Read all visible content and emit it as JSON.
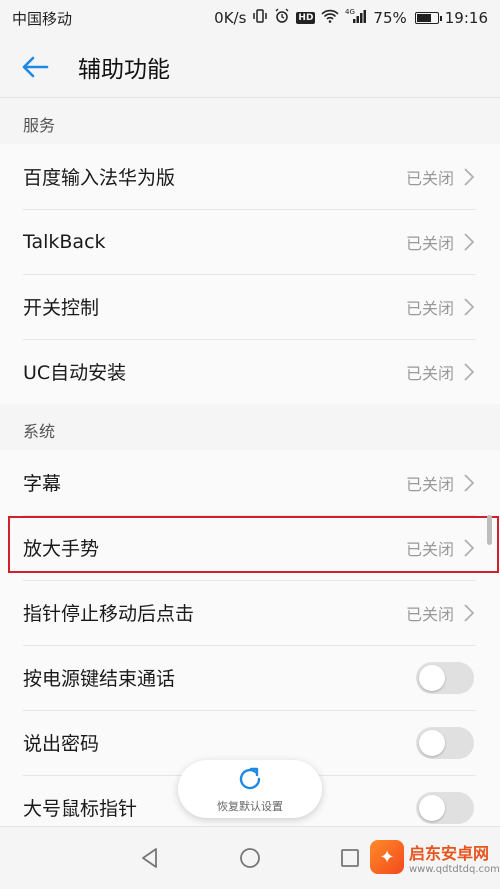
{
  "statusbar": {
    "carrier": "中国移动",
    "speed": "0K/s",
    "network": "4G",
    "battery_percent": "75%",
    "battery_level": 0.75,
    "time": "19:16"
  },
  "appbar": {
    "title": "辅助功能"
  },
  "sections": {
    "services": {
      "header": "服务",
      "items": [
        {
          "label": "百度输入法华为版",
          "status": "已关闭"
        },
        {
          "label": "TalkBack",
          "status": "已关闭"
        },
        {
          "label": "开关控制",
          "status": "已关闭"
        },
        {
          "label": "UC自动安装",
          "status": "已关闭"
        }
      ]
    },
    "system": {
      "header": "系统",
      "items": [
        {
          "label": "字幕",
          "status": "已关闭"
        },
        {
          "label": "放大手势",
          "status": "已关闭"
        },
        {
          "label": "指针停止移动后点击",
          "status": "已关闭"
        },
        {
          "label": "按电源键结束通话",
          "toggle_on": false
        },
        {
          "label": "说出密码",
          "toggle_on": false
        },
        {
          "label": "大号鼠标指针",
          "toggle_on": false
        }
      ]
    }
  },
  "restore": {
    "label": "恢复默认设置"
  },
  "watermark": {
    "name": "启东安卓网",
    "url": "www.qdtdtdq.com"
  },
  "colors": {
    "accent": "#1e88e5",
    "highlight": "#d0202b"
  }
}
